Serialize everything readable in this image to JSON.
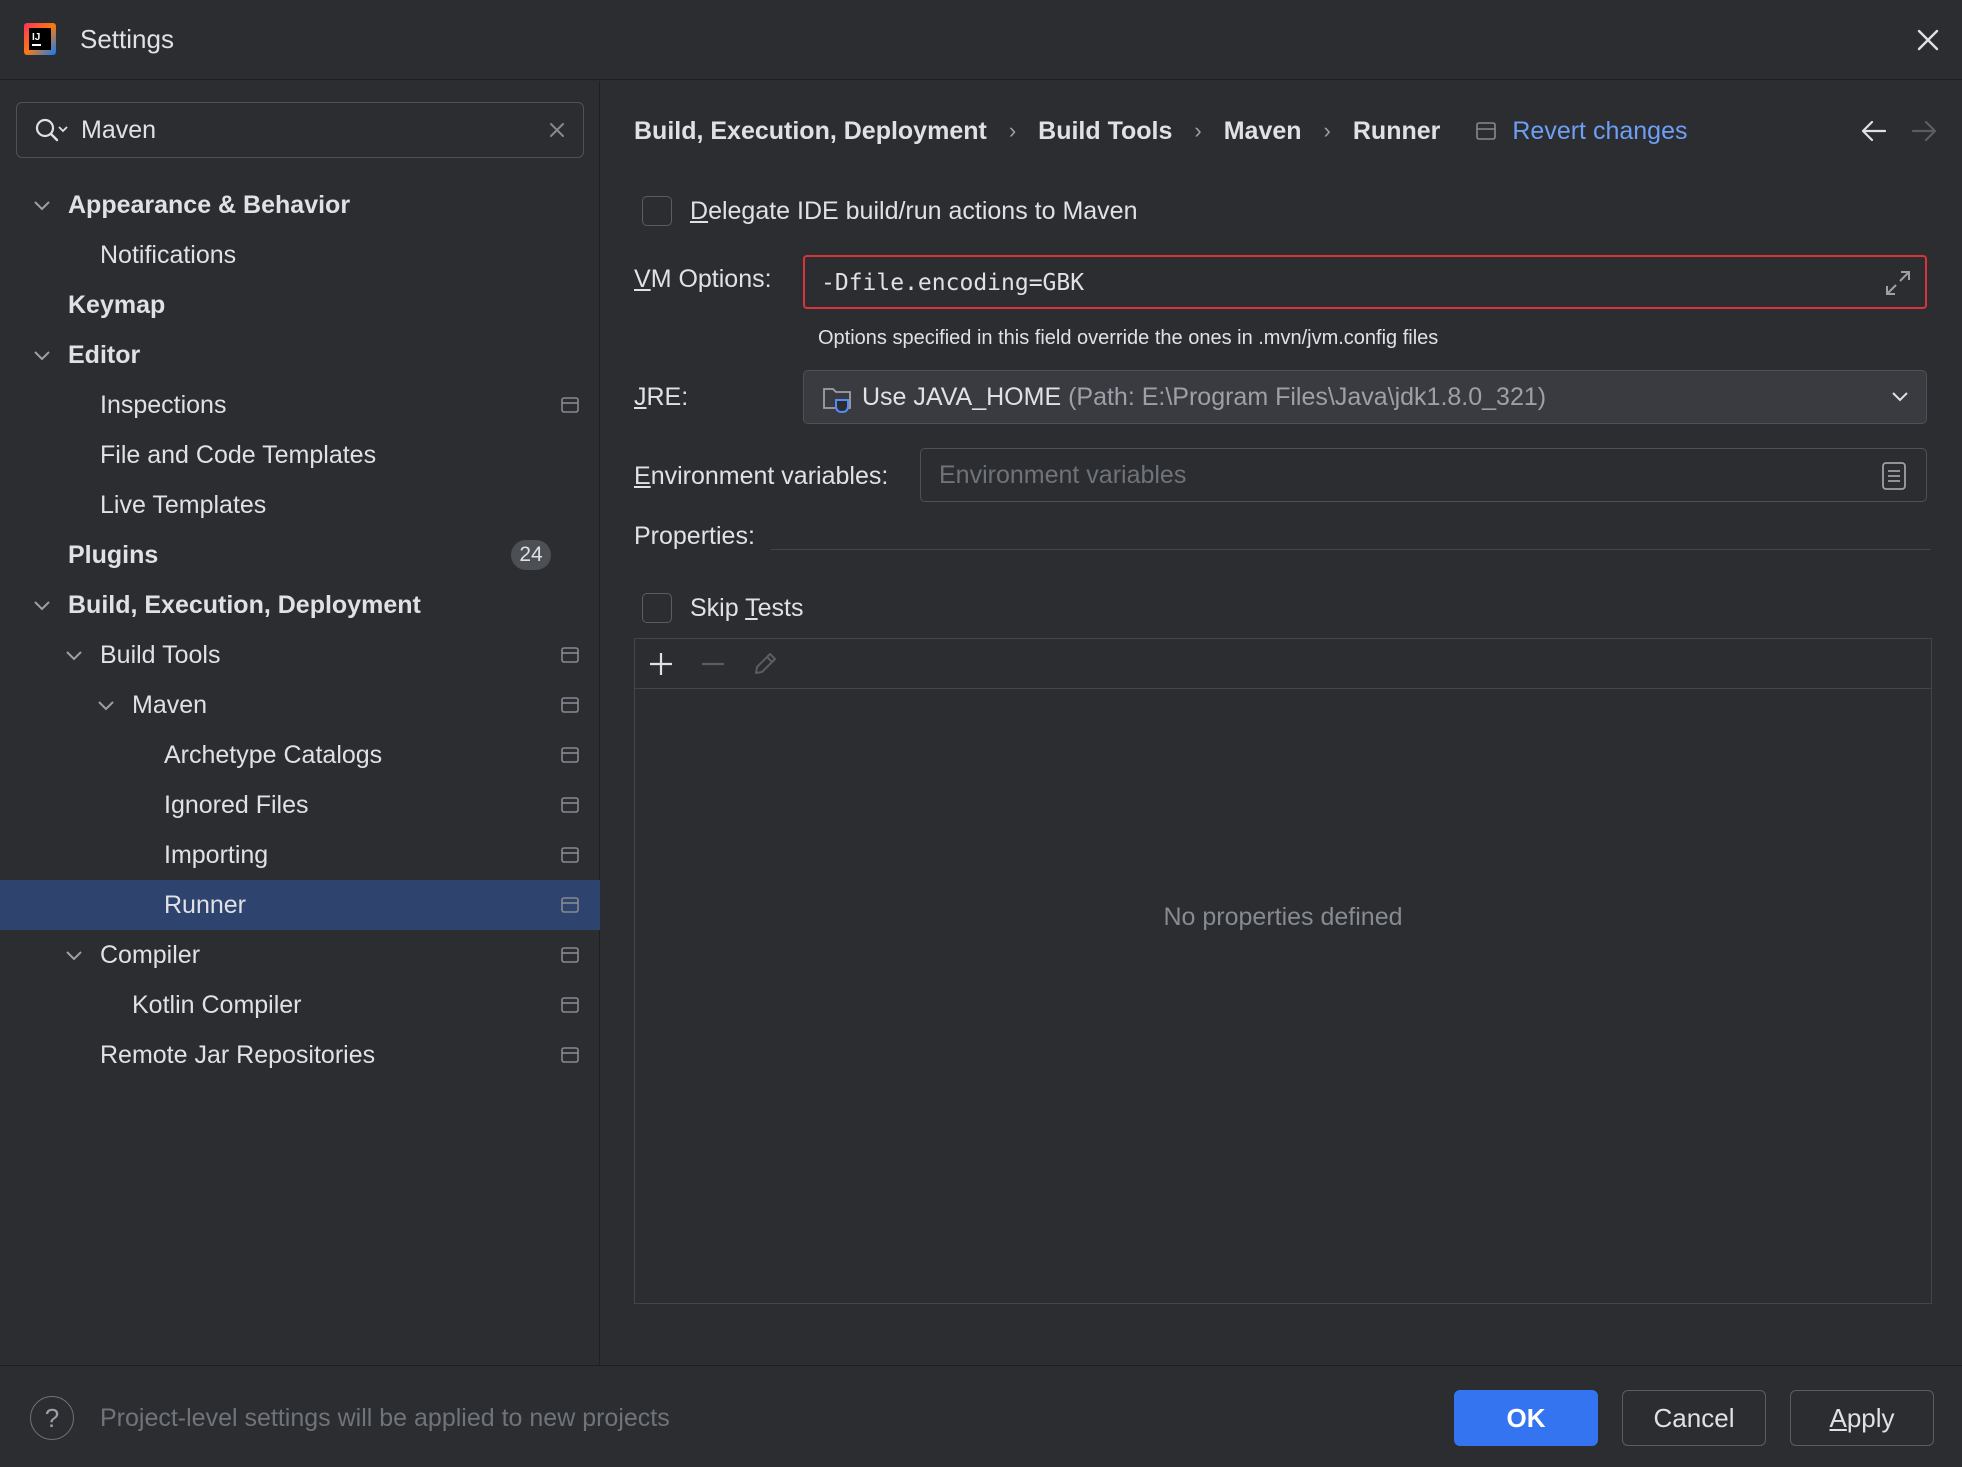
{
  "window": {
    "title": "Settings",
    "accent_color": "#3574f0",
    "selection_color": "#2e436e",
    "link_color": "#6e9ff5",
    "error_border_color": "#d9343a"
  },
  "search": {
    "value": "Maven"
  },
  "tree": {
    "appearance": "Appearance & Behavior",
    "notifications": "Notifications",
    "keymap": "Keymap",
    "editor": "Editor",
    "inspections": "Inspections",
    "file_templates": "File and Code Templates",
    "live_templates": "Live Templates",
    "plugins": "Plugins",
    "plugins_badge": "24",
    "build": "Build, Execution, Deployment",
    "build_tools": "Build Tools",
    "maven": "Maven",
    "archetype": "Archetype Catalogs",
    "ignored": "Ignored Files",
    "importing": "Importing",
    "runner": "Runner",
    "compiler": "Compiler",
    "kotlin": "Kotlin Compiler",
    "remote_jar": "Remote Jar Repositories"
  },
  "breadcrumb": {
    "items": [
      "Build, Execution, Deployment",
      "Build Tools",
      "Maven",
      "Runner"
    ],
    "separator": "›",
    "revert": "Revert changes"
  },
  "form": {
    "delegate_pre": "",
    "delegate_key": "D",
    "delegate_post": "elegate IDE build/run actions to Maven",
    "vm_label_key": "V",
    "vm_label_post": "M Options:",
    "vm_value": "-Dfile.encoding=GBK",
    "vm_hint": "Options specified in this field override the ones in .mvn/jvm.config files",
    "jre_label_key": "J",
    "jre_label_post": "RE:",
    "jre_value": "Use JAVA_HOME",
    "jre_path": "(Path: E:\\Program Files\\Java\\jdk1.8.0_321)",
    "env_label_key": "E",
    "env_label_post": "nvironment variables:",
    "env_placeholder": "Environment variables",
    "properties_label": "Properties:",
    "skip_pre": "Skip ",
    "skip_key": "T",
    "skip_post": "ests",
    "empty_props": "No properties defined"
  },
  "footer": {
    "help": "?",
    "note": "Project-level settings will be applied to new projects",
    "ok": "OK",
    "cancel": "Cancel",
    "apply_key": "A",
    "apply_post": "pply"
  }
}
